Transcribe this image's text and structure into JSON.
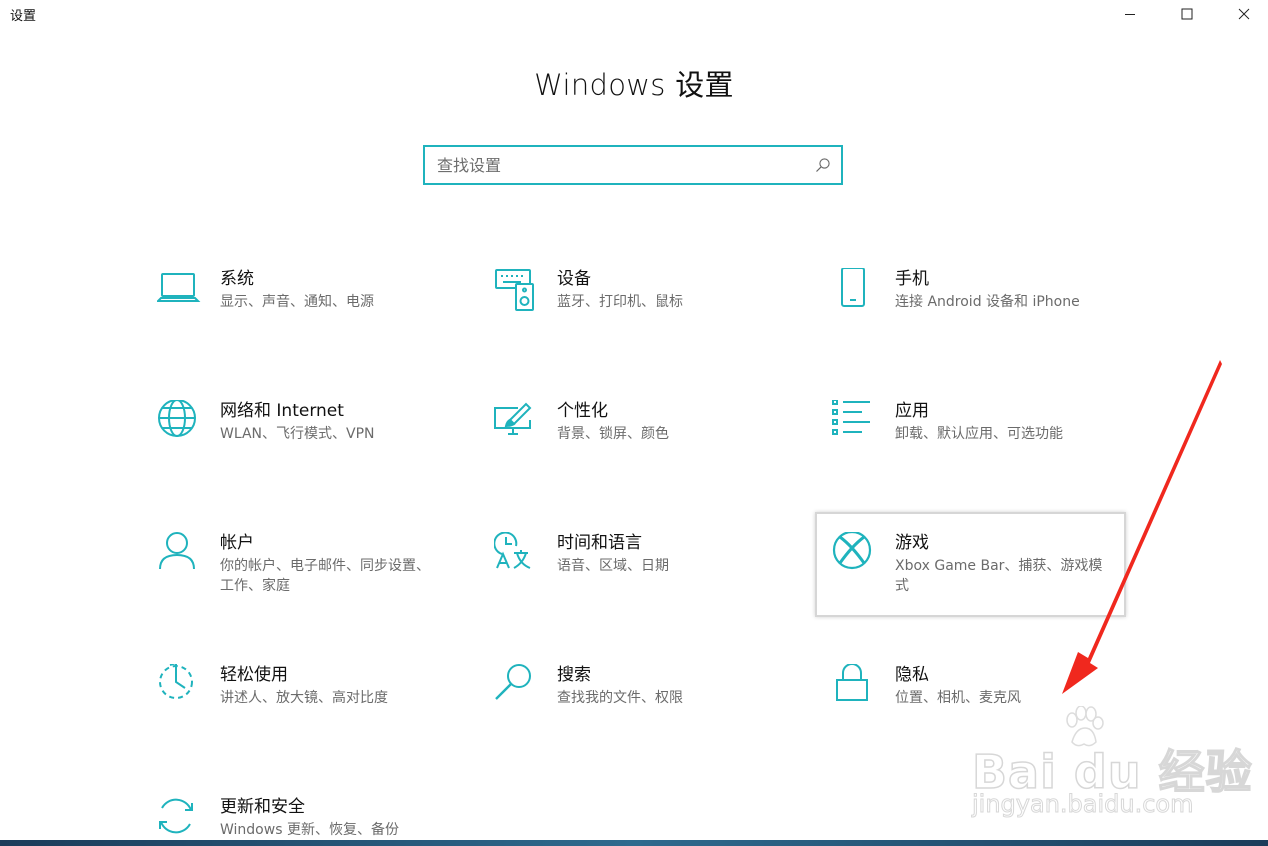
{
  "window": {
    "title": "设置",
    "controls": {
      "minimize": "minimize-icon",
      "maximize": "maximize-icon",
      "close": "close-icon"
    }
  },
  "page": {
    "title": "Windows 设置"
  },
  "search": {
    "placeholder": "查找设置",
    "value": "",
    "icon": "search-icon"
  },
  "accent_color": "#1fb3bd",
  "tiles": [
    {
      "id": "system",
      "icon": "laptop-icon",
      "title": "系统",
      "subtitle": "显示、声音、通知、电源"
    },
    {
      "id": "devices",
      "icon": "keyboard-speaker-icon",
      "title": "设备",
      "subtitle": "蓝牙、打印机、鼠标"
    },
    {
      "id": "phone",
      "icon": "phone-icon",
      "title": "手机",
      "subtitle": "连接 Android 设备和 iPhone"
    },
    {
      "id": "network",
      "icon": "globe-icon",
      "title": "网络和 Internet",
      "subtitle": "WLAN、飞行模式、VPN"
    },
    {
      "id": "personalization",
      "icon": "paint-monitor-icon",
      "title": "个性化",
      "subtitle": "背景、锁屏、颜色"
    },
    {
      "id": "apps",
      "icon": "app-list-icon",
      "title": "应用",
      "subtitle": "卸载、默认应用、可选功能"
    },
    {
      "id": "accounts",
      "icon": "person-icon",
      "title": "帐户",
      "subtitle": "你的帐户、电子邮件、同步设置、工作、家庭"
    },
    {
      "id": "time-language",
      "icon": "clock-language-icon",
      "title": "时间和语言",
      "subtitle": "语音、区域、日期"
    },
    {
      "id": "gaming",
      "icon": "xbox-icon",
      "title": "游戏",
      "subtitle": "Xbox Game Bar、捕获、游戏模式"
    },
    {
      "id": "ease-of-access",
      "icon": "ease-of-access-icon",
      "title": "轻松使用",
      "subtitle": "讲述人、放大镜、高对比度"
    },
    {
      "id": "search",
      "icon": "magnifier-icon",
      "title": "搜索",
      "subtitle": "查找我的文件、权限"
    },
    {
      "id": "privacy",
      "icon": "lock-icon",
      "title": "隐私",
      "subtitle": "位置、相机、麦克风"
    },
    {
      "id": "update-security",
      "icon": "sync-icon",
      "title": "更新和安全",
      "subtitle": "Windows 更新、恢复、备份"
    }
  ],
  "focused_tile": "gaming",
  "annotation": {
    "type": "arrow",
    "color": "#f0281e",
    "points_to": "privacy"
  },
  "watermark": {
    "brand": "Bai du 经验",
    "url": "jingyan.baidu.com"
  }
}
